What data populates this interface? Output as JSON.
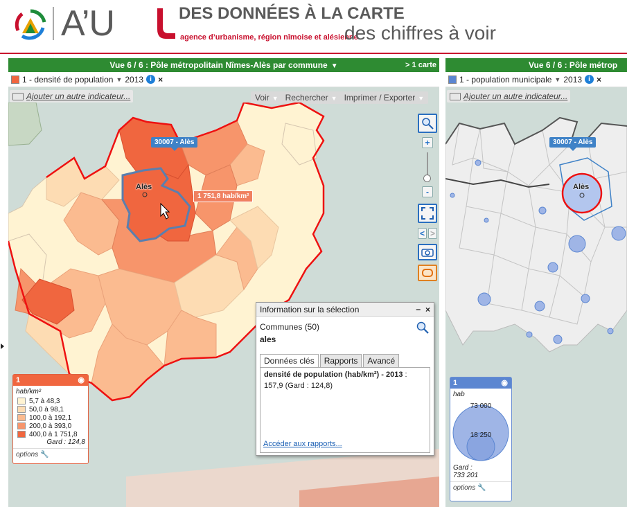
{
  "header": {
    "logo_text": "A’U",
    "brand_line1": "DES DONNÉES À LA CARTE",
    "brand_line2": "agence d’urbanisme, région nîmoise et alésienne",
    "brand_line3": "des chiffres à voir"
  },
  "left_panel": {
    "title": "Vue 6 / 6 : Pôle métropolitain Nîmes-Alès par commune",
    "more_label": "> 1 carte",
    "indicator_label": "1 - densité de population",
    "indicator_year": "2013",
    "indicator_color": "#f0663f",
    "add_indicator": "Ajouter un autre indicateur...",
    "toolbar": [
      "Voir",
      "Rechercher",
      "Imprimer / Exporter"
    ],
    "callout": "30007 - Alès",
    "value_tip": "1 751,8 hab/km²",
    "place_label": "Alès",
    "legend": {
      "number": "1",
      "unit": "hab/km²",
      "classes": [
        {
          "label": "5,7 à 48,3",
          "color": "#fff3d2"
        },
        {
          "label": "50,0 à 98,1",
          "color": "#fddcb3"
        },
        {
          "label": "100,0 à 192,1",
          "color": "#fbbb90"
        },
        {
          "label": "200,0 à 393,0",
          "color": "#f7956b"
        },
        {
          "label": "400,0 à 1 751,8",
          "color": "#f0663f"
        }
      ],
      "reference": "Gard : 124,8",
      "options": "options"
    }
  },
  "right_panel": {
    "title": "Vue 6 / 6 : Pôle métrop",
    "indicator_label": "1 - population municipale",
    "indicator_year": "2013",
    "indicator_color": "#5b86d1",
    "add_indicator": "Ajouter un autre indicateur...",
    "callout": "30007 - Alès",
    "place_label": "Alès",
    "legend": {
      "number": "1",
      "unit": "hab",
      "big_value": "73 000",
      "small_value": "18 250",
      "reference_label": "Gard :",
      "reference_value": "733 201",
      "options": "options"
    }
  },
  "info_popup": {
    "title": "Information sur la sélection",
    "minimize": "−",
    "close": "×",
    "communes": "Communes (50)",
    "selected": "ales",
    "tabs": [
      "Données clés",
      "Rapports",
      "Avancé"
    ],
    "key_label": "densité de population (hab/km²) - 2013",
    "key_suffix": " :",
    "key_value": "157,9 (Gard : 124,8)",
    "reports_link": "Accéder aux rapports..."
  }
}
